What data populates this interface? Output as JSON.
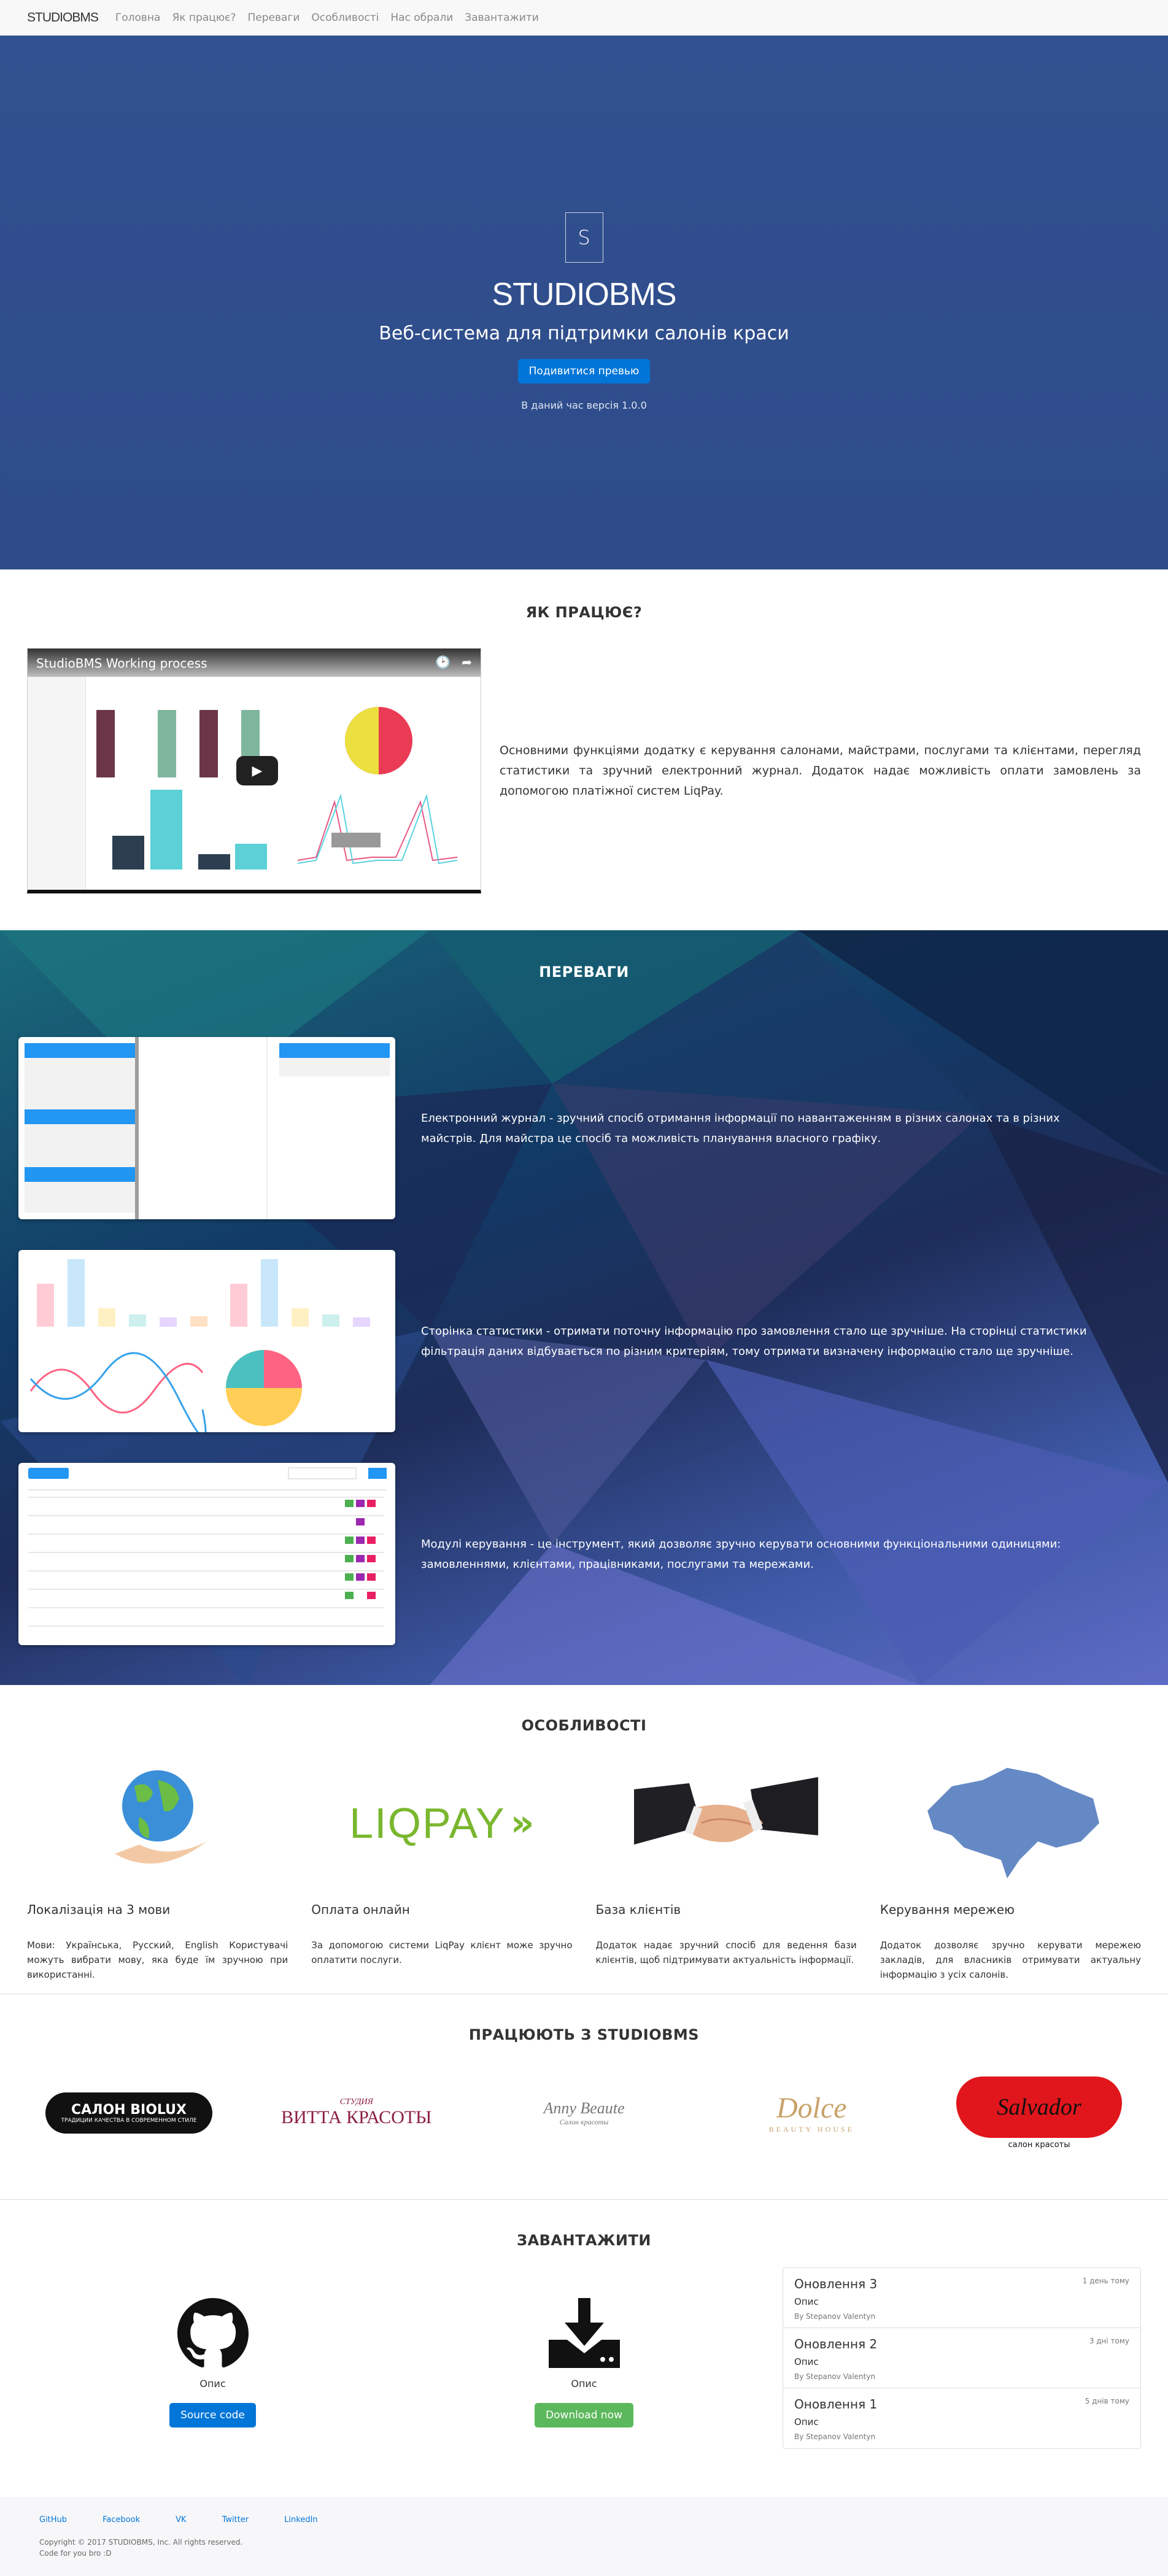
{
  "nav": {
    "brand": "STUDIOBMS",
    "links": [
      "Головна",
      "Як працює?",
      "Переваги",
      "Особливості",
      "Нас обрали",
      "Завантажити"
    ]
  },
  "hero": {
    "logo_letter": "S",
    "title": "STUDIOBMS",
    "subtitle": "Веб-система для підтримки салонів краси",
    "button": "Подивитися превью",
    "version": "В даний час версія 1.0.0"
  },
  "how": {
    "title": "ЯК ПРАЦЮЄ?",
    "video_title": "StudioBMS Working process",
    "text": "Основними функціями додатку є керування салонами, майстрами, послугами та клієнтами, перегляд статистики та зручний електронний журнал. Додаток надає можливість оплати замовлень за допомогою платіжної систем LiqPay."
  },
  "advantages": {
    "title": "ПЕРЕВАГИ",
    "items": [
      {
        "text": "Електронний журнал - зручний спосіб отримання інформації по навантаженням в різних салонах та в різних майстрів. Для майстра це спосіб та можливість планування власного графіку."
      },
      {
        "text": "Сторінка статистики - отримати поточну інформацію про замовлення стало ще зручніше. На сторінці статистики фільтрація даних відбувається по різним критеріям, тому отримати визначену інформацію стало ще зручніше."
      },
      {
        "text": "Модулі керування - це інструмент, який дозволяє зручно керувати основними функціональними одиницями: замовленнями, клієнтами, працівниками, послугами та мережами."
      }
    ]
  },
  "features": {
    "title": "ОСОБЛИВОСТІ",
    "items": [
      {
        "title": "Локалізація на 3 мови",
        "desc": "Мови: Українська, Русский, English Користувачі можуть вибрати мову, яка буде їм зручною при використанні."
      },
      {
        "title": "Оплата онлайн",
        "desc": "За допомогою системи LiqPay клієнт може зручно оплатити послуги.",
        "logo": "LIQPAY"
      },
      {
        "title": "База клієнтів",
        "desc": "Додаток надає зручний спосіб для ведення бази клієнтів, щоб підтримувати актуальність інформації."
      },
      {
        "title": "Керування мережею",
        "desc": "Додаток дозволяє зручно керувати мережею закладів, для власників отримувати актуальну інформацію з усіх салонів."
      }
    ]
  },
  "partners": {
    "title": "ПРАЦЮЮТЬ З STUDIOBMS",
    "logos": [
      {
        "text": "САЛОН BIOLUX",
        "sub": "ТРАДИЦИИ КАЧЕСТВА В СОВРЕМЕННОМ СТИЛЕ"
      },
      {
        "text": "ВИТТА КРАСОТЫ",
        "sub": "СТУДИЯ"
      },
      {
        "text": "Anny Beaute",
        "sub": "Салон красоты"
      },
      {
        "text": "Dolce",
        "sub": "BEAUTY HOUSE"
      },
      {
        "text": "Salvador",
        "sub": "салон красоты"
      }
    ]
  },
  "downloads": {
    "title": "ЗАВАНТАЖИТИ",
    "cols": [
      {
        "label": "Опис",
        "button": "Source code"
      },
      {
        "label": "Опис",
        "button": "Download now"
      }
    ],
    "updates": [
      {
        "title": "Оновлення 3",
        "desc": "Опис",
        "by": "By Stepanov Valentyn",
        "time": "1 день тому"
      },
      {
        "title": "Оновлення 2",
        "desc": "Опис",
        "by": "By Stepanov Valentyn",
        "time": "3 дні тому"
      },
      {
        "title": "Оновлення 1",
        "desc": "Опис",
        "by": "By Stepanov Valentyn",
        "time": "5 днів тому"
      }
    ]
  },
  "footer": {
    "links": [
      "GitHub",
      "Facebook",
      "VK",
      "Twitter",
      "LinkedIn"
    ],
    "copyright": "Copyright © 2017 STUDIOBMS, Inc. All rights reserved.",
    "credit": "Code for you bro :D"
  }
}
